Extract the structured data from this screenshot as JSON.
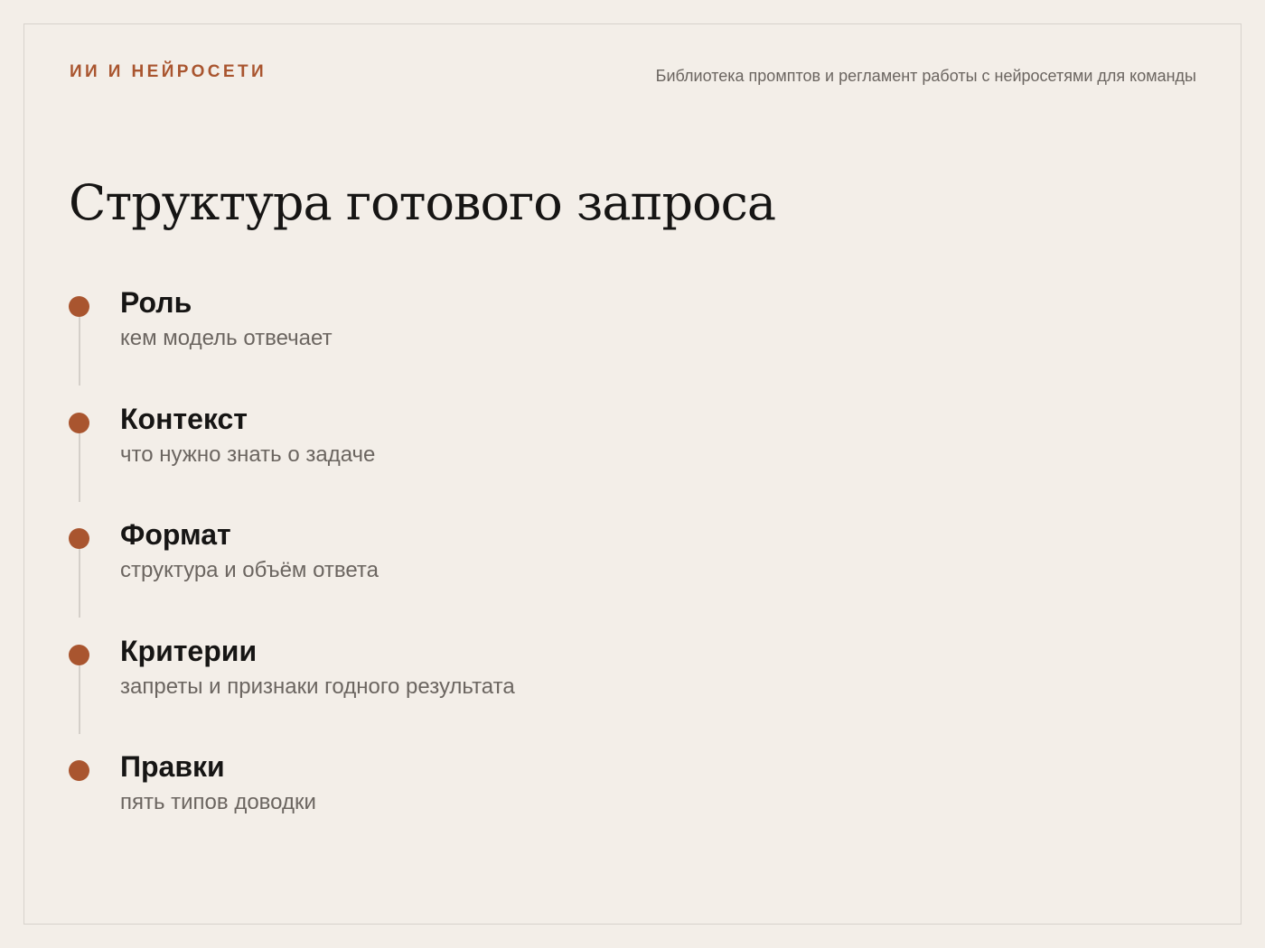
{
  "header": {
    "eyebrow": "ИИ И НЕЙРОСЕТИ",
    "tagline": "Библиотека промптов и регламент работы с нейросетями для команды"
  },
  "page": {
    "title": "Структура готового запроса"
  },
  "steps": [
    {
      "title": "Роль",
      "description": "кем модель отвечает"
    },
    {
      "title": "Контекст",
      "description": "что нужно знать о задаче"
    },
    {
      "title": "Формат",
      "description": "структура и объём ответа"
    },
    {
      "title": "Критерии",
      "description": "запреты и признаки годного результата"
    },
    {
      "title": "Правки",
      "description": "пять типов доводки"
    }
  ],
  "colors": {
    "accent": "#a9552f",
    "background": "#f3eee8",
    "text": "#161514",
    "muted": "#6b6560"
  }
}
